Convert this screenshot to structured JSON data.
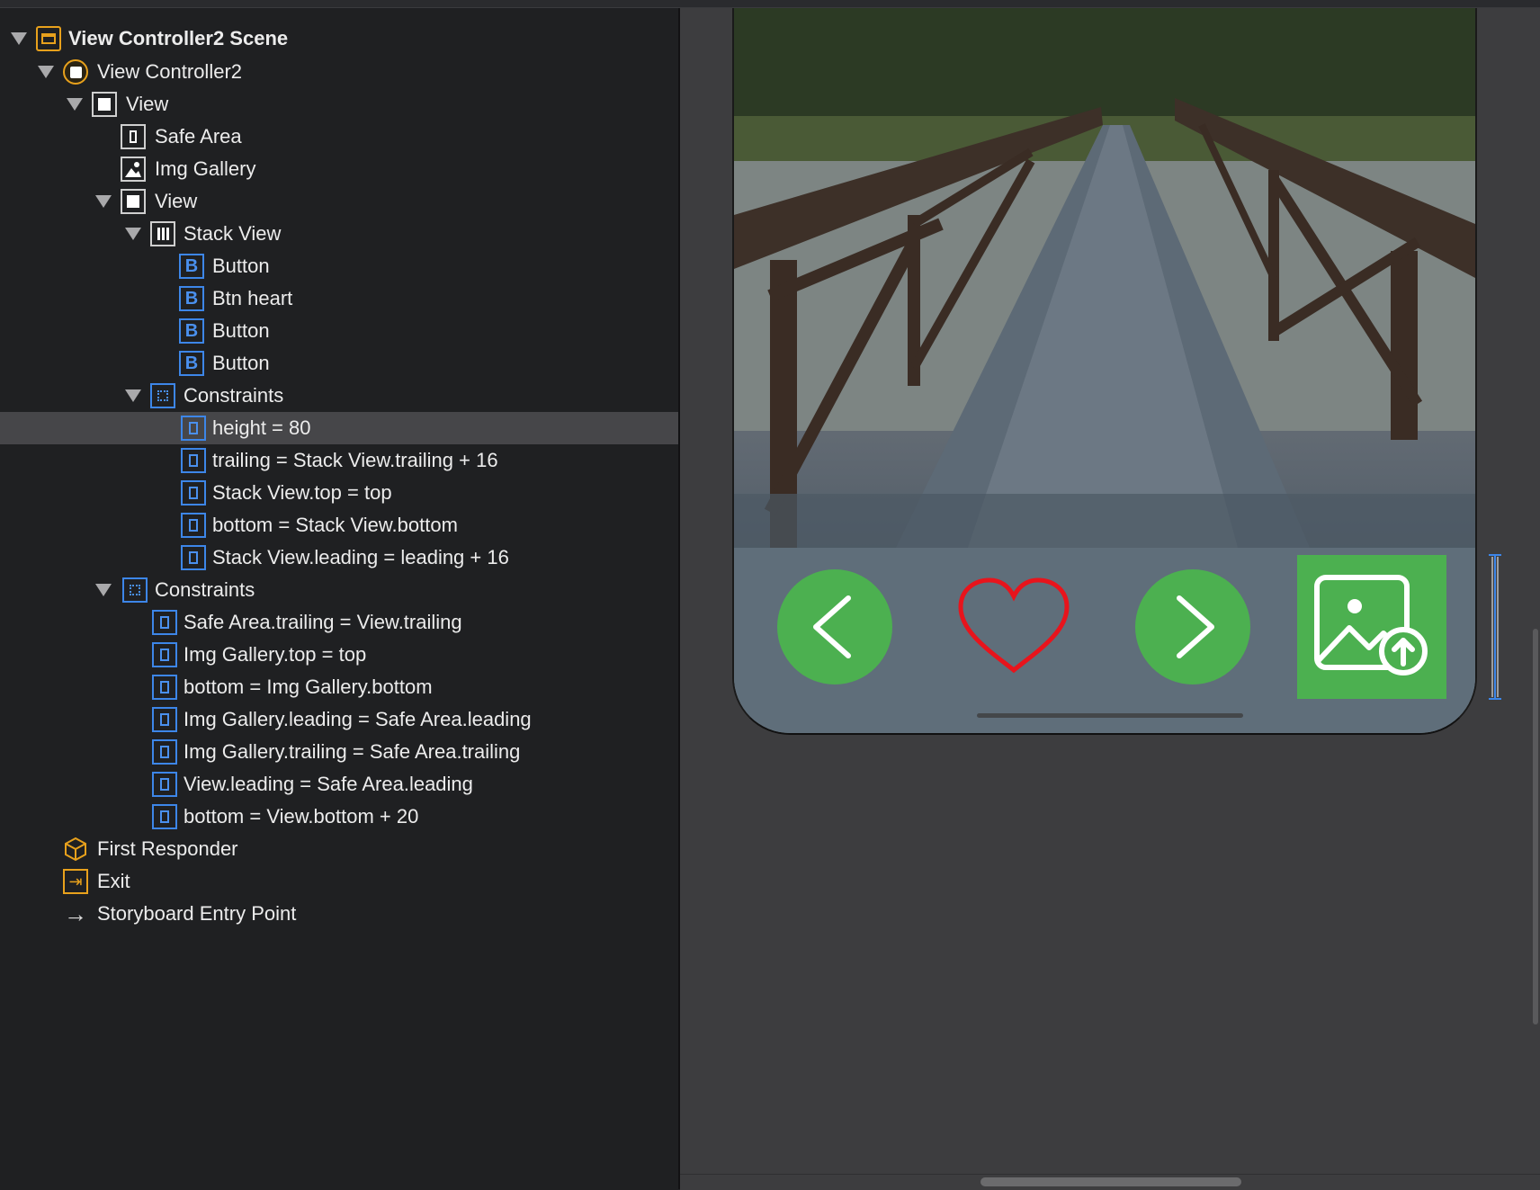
{
  "outline": {
    "items": [
      {
        "label": "View Controller2 Scene",
        "icon": "scene-icon",
        "disclosure": true
      },
      {
        "label": "View Controller2",
        "icon": "view-controller-icon",
        "disclosure": true
      },
      {
        "label": "View",
        "icon": "view-icon",
        "disclosure": true
      },
      {
        "label": "Safe Area",
        "icon": "safe-area-icon",
        "disclosure": false
      },
      {
        "label": "Img Gallery",
        "icon": "image-view-icon",
        "disclosure": false
      },
      {
        "label": "View",
        "icon": "view-icon",
        "disclosure": true
      },
      {
        "label": "Stack View",
        "icon": "stack-view-icon",
        "disclosure": true
      },
      {
        "label": "Button",
        "icon": "button-icon",
        "disclosure": false
      },
      {
        "label": "Btn heart",
        "icon": "button-icon",
        "disclosure": false
      },
      {
        "label": "Button",
        "icon": "button-icon",
        "disclosure": false
      },
      {
        "label": "Button",
        "icon": "button-icon",
        "disclosure": false
      },
      {
        "label": "Constraints",
        "icon": "constraints-icon",
        "disclosure": true
      },
      {
        "label": "height = 80",
        "icon": "constraint-icon",
        "disclosure": false,
        "selected": true
      },
      {
        "label": "trailing = Stack View.trailing + 16",
        "icon": "constraint-icon",
        "disclosure": false
      },
      {
        "label": "Stack View.top = top",
        "icon": "constraint-icon",
        "disclosure": false
      },
      {
        "label": "bottom = Stack View.bottom",
        "icon": "constraint-icon",
        "disclosure": false
      },
      {
        "label": "Stack View.leading = leading + 16",
        "icon": "constraint-icon",
        "disclosure": false
      },
      {
        "label": "Constraints",
        "icon": "constraints-icon",
        "disclosure": true
      },
      {
        "label": "Safe Area.trailing = View.trailing",
        "icon": "constraint-icon",
        "disclosure": false
      },
      {
        "label": "Img Gallery.top = top",
        "icon": "constraint-icon",
        "disclosure": false
      },
      {
        "label": "bottom = Img Gallery.bottom",
        "icon": "constraint-icon",
        "disclosure": false
      },
      {
        "label": "Img Gallery.leading = Safe Area.leading",
        "icon": "constraint-icon",
        "disclosure": false
      },
      {
        "label": "Img Gallery.trailing = Safe Area.trailing",
        "icon": "constraint-icon",
        "disclosure": false
      },
      {
        "label": "View.leading = Safe Area.leading",
        "icon": "constraint-icon",
        "disclosure": false
      },
      {
        "label": "bottom = View.bottom + 20",
        "icon": "constraint-icon",
        "disclosure": false
      },
      {
        "label": "First Responder",
        "icon": "first-responder-icon",
        "disclosure": false
      },
      {
        "label": "Exit",
        "icon": "exit-icon",
        "disclosure": false
      },
      {
        "label": "Storyboard Entry Point",
        "icon": "arrow-right-icon",
        "disclosure": false
      }
    ]
  },
  "canvas": {
    "buttons": [
      {
        "icon": "chevron-left-icon"
      },
      {
        "icon": "heart-icon"
      },
      {
        "icon": "chevron-right-icon"
      },
      {
        "icon": "image-upload-icon"
      }
    ],
    "colors": {
      "button_green": "#4cb050",
      "heart_red": "#e8141c"
    }
  }
}
